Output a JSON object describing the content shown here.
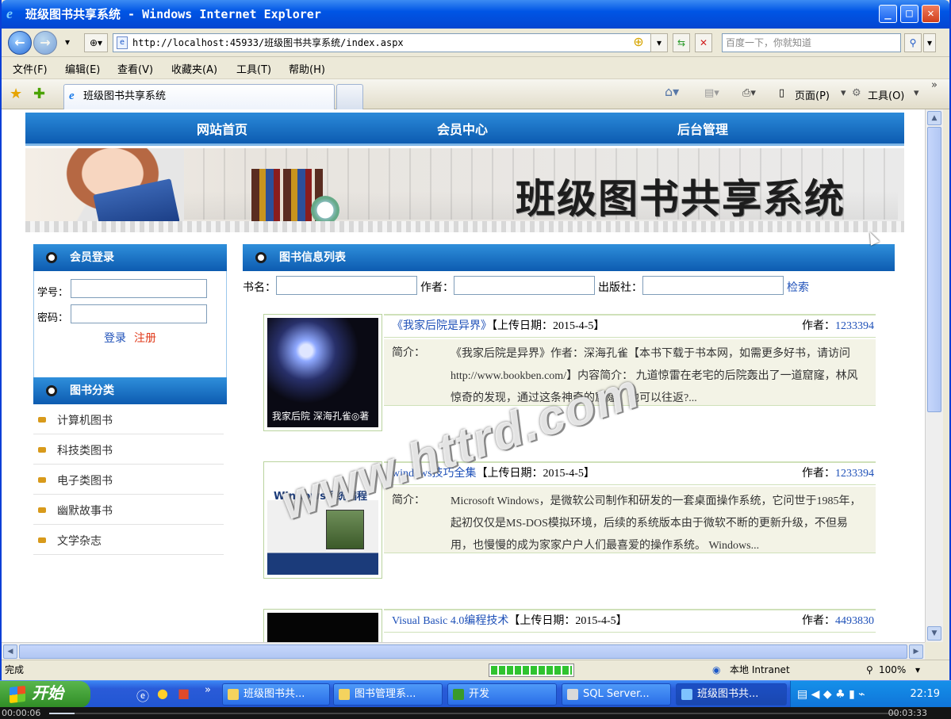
{
  "window": {
    "title": "班级图书共享系统 - Windows Internet Explorer",
    "minimize": "_",
    "maximize": "□",
    "close": "✕"
  },
  "address_bar": {
    "url": "http://localhost:45933/班级图书共享系统/index.aspx",
    "search_placeholder": "百度一下，你就知道"
  },
  "menu": [
    "文件(F)",
    "编辑(E)",
    "查看(V)",
    "收藏夹(A)",
    "工具(T)",
    "帮助(H)"
  ],
  "tab": {
    "label": "班级图书共享系统"
  },
  "command_bar": {
    "page": "页面(P)",
    "tools": "工具(O)"
  },
  "page": {
    "nav": [
      "网站首页",
      "会员中心",
      "后台管理"
    ],
    "banner_title": "班级图书共享系统",
    "login": {
      "header": "会员登录",
      "id_label": "学号：",
      "pwd_label": "密码：",
      "login_link": "登录",
      "register_link": "注册"
    },
    "categories": {
      "header": "图书分类",
      "items": [
        "计算机图书",
        "科技类图书",
        "电子类图书",
        "幽默故事书",
        "文学杂志"
      ]
    },
    "list": {
      "header": "图书信息列表",
      "search": {
        "name_label": "书名：",
        "author_label": "作者：",
        "publisher_label": "出版社：",
        "button": "检索"
      },
      "books": [
        {
          "title": "《我家后院是异界》",
          "date": "【上传日期：2015-4-5】",
          "author_label": "作者：",
          "author": "1233394",
          "intro_label": "简介：",
          "intro": "《我家后院是异界》作者：深海孔雀【本书下载于书本网，如需更多好书，请访问 http://www.bookben.com/】内容简介： 九道惊雷在老宅的后院轰出了一道窟窿，林风惊奇的发现，通过这条神奇的窟窿，他可以往返?...",
          "cover_text": "我家后院 深海孔雀◎著",
          "cover_colors": [
            "#0a0a14",
            "#8fa9ff"
          ]
        },
        {
          "title": "windows技巧全集",
          "date": "【上传日期：2015-4-5】",
          "author_label": "作者：",
          "author": "1233394",
          "intro_label": "简介：",
          "intro": "Microsoft Windows，是微软公司制作和研发的一套桌面操作系统，它问世于1985年，起初仅仅是MS-DOS模拟环境，后续的系统版本由于微软不断的更新升级，不但易用，也慢慢的成为家家户户人们最喜爱的操作系统。 Windows...",
          "cover_text": "Windows系统编程",
          "cover_colors": [
            "#ffffff",
            "#1b3b7a"
          ]
        },
        {
          "title": "Visual Basic 4.0编程技术",
          "date": "【上传日期：2015-4-5】",
          "author_label": "作者：",
          "author": "4493830",
          "intro_label": "",
          "intro": "",
          "cover_text": "",
          "cover_colors": [
            "#050505",
            "#222222"
          ]
        }
      ]
    },
    "watermark": "www.httrd.com"
  },
  "status_bar": {
    "text": "完成",
    "zone": "本地 Intranet",
    "zoom": "100%",
    "progress": 1.0
  },
  "taskbar": {
    "start": "开始",
    "tasks": [
      "班级图书共...",
      "图书管理系...",
      "开发",
      "SQL Server...",
      "班级图书共..."
    ],
    "clock": "22:19"
  },
  "player": {
    "elapsed": "00:00:06",
    "total": "00:03:33",
    "position": 0.03
  }
}
